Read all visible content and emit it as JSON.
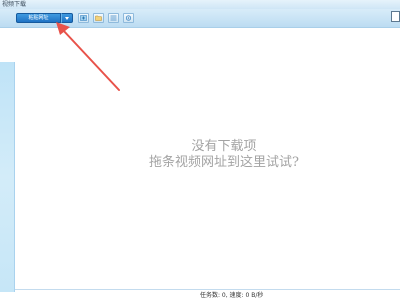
{
  "window": {
    "title": "视频下载"
  },
  "toolbar": {
    "paste_label": "粘贴网址",
    "buttons": [
      {
        "name": "new-task-icon"
      },
      {
        "name": "open-folder-icon"
      },
      {
        "name": "list-view-icon"
      },
      {
        "name": "settings-icon"
      }
    ]
  },
  "empty_state": {
    "line1": "没有下载项",
    "line2": "拖条视频网址到这里试试?"
  },
  "status": {
    "text": "任务数: 0, 速度: 0 B/秒"
  },
  "colors": {
    "accent": "#1f73c4",
    "arrow": "#e8524a",
    "placeholder_text": "#a3a3a3"
  }
}
